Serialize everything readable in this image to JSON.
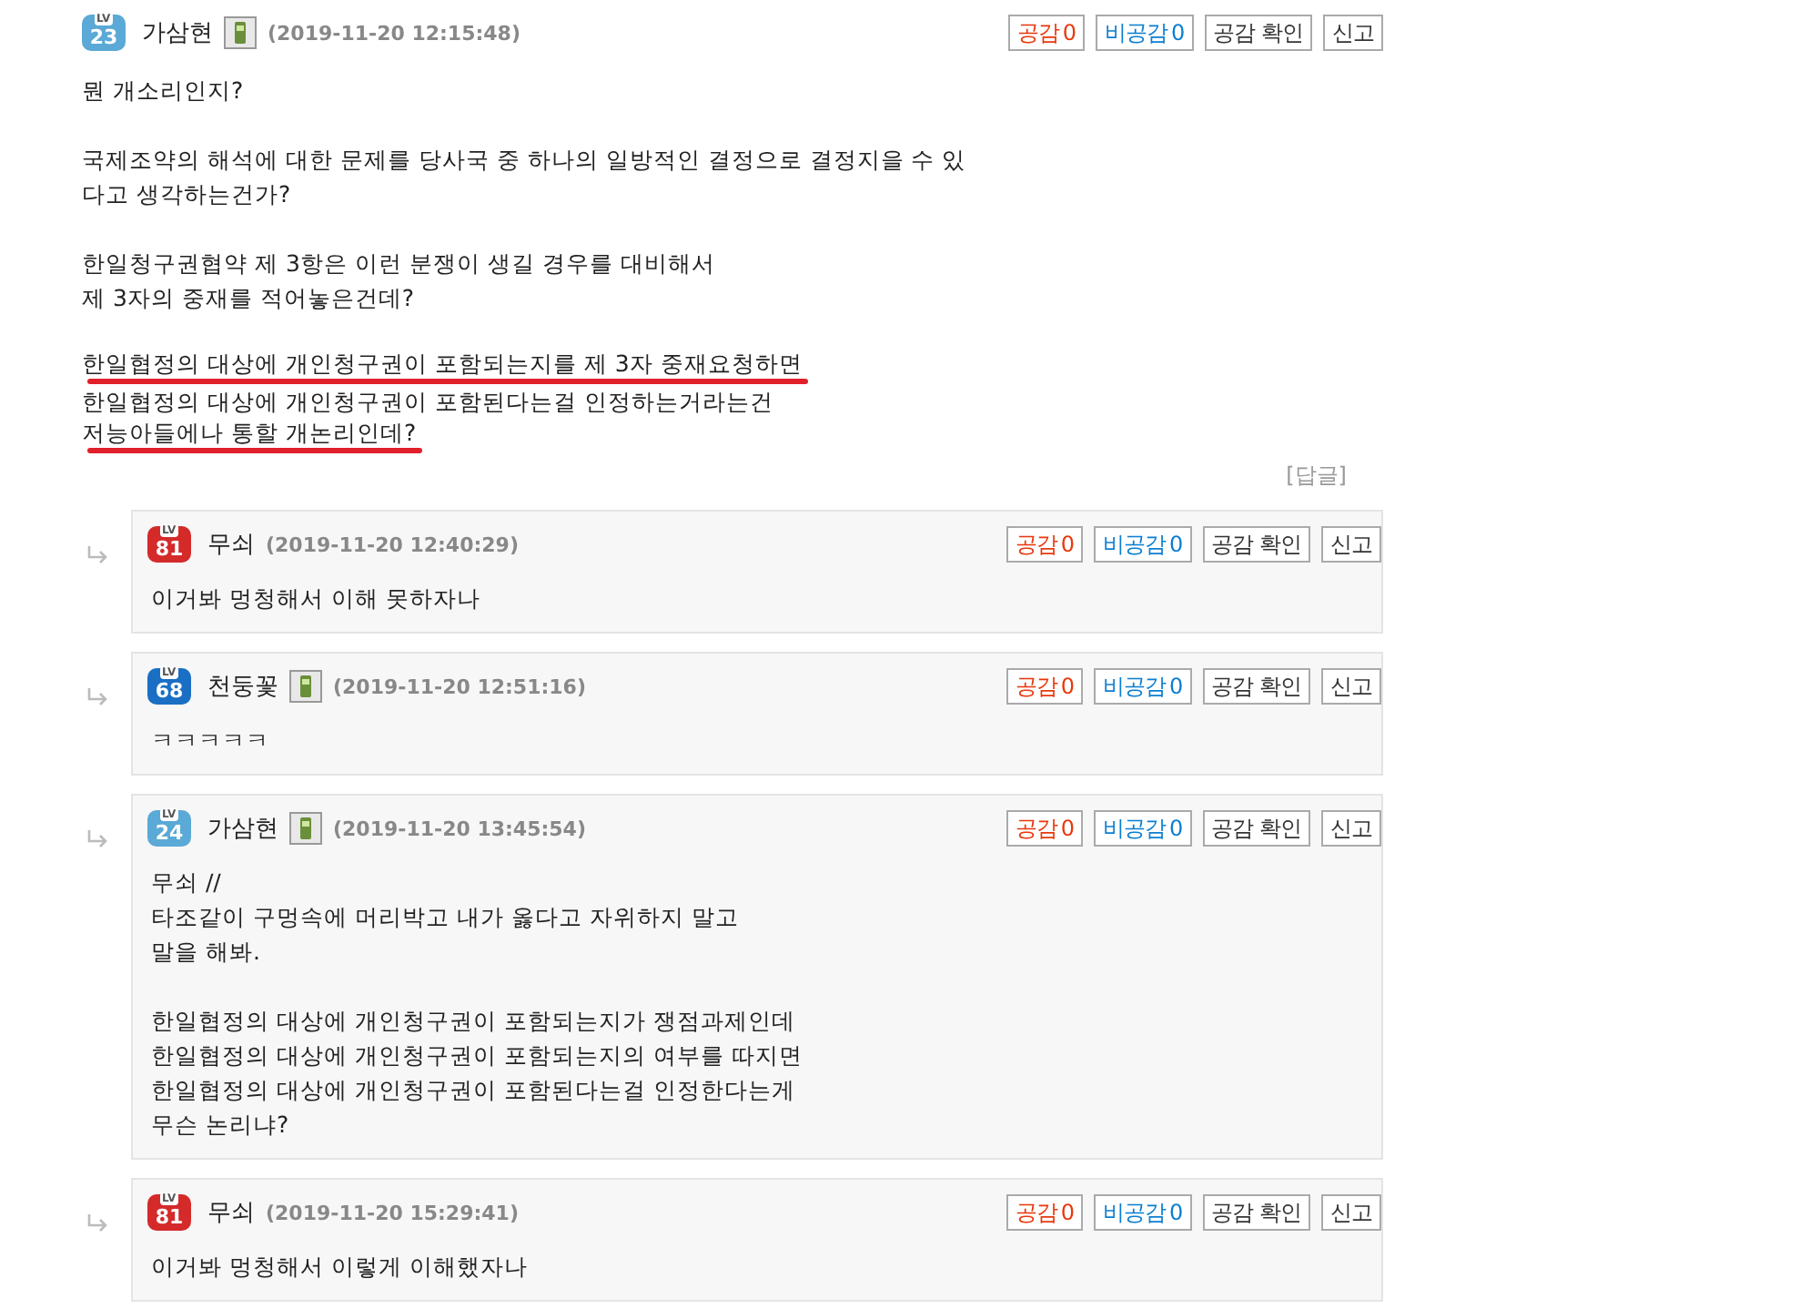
{
  "post": {
    "author": {
      "badge": {
        "label": "LV",
        "level": "23",
        "color": "#5aa9d6"
      },
      "name": "가삼현",
      "mobile": true,
      "date": "(2019-11-20 12:15:48)"
    },
    "actions": [
      {
        "kind": "like",
        "text": "공감",
        "count": "0"
      },
      {
        "kind": "dislike",
        "text": "비공감",
        "count": "0"
      },
      {
        "kind": "plain",
        "text": "공감 확인"
      },
      {
        "kind": "plain",
        "text": "신고"
      }
    ],
    "paragraphs": [
      [
        {
          "text": "뭔 개소리인지?",
          "marked": false
        }
      ],
      [
        {
          "text": "국제조약의 해석에 대한 문제를 당사국 중 하나의 일방적인 결정으로 결정지을 수 있",
          "marked": false
        },
        {
          "text": "다고 생각하는건가?",
          "marked": false
        }
      ],
      [
        {
          "text": "한일청구권협약 제 3항은 이런 분쟁이 생길 경우를 대비해서",
          "marked": false
        },
        {
          "text": "제 3자의 중재를 적어놓은건데?",
          "marked": false
        }
      ],
      [
        {
          "text": "한일협정의 대상에 개인청구권이 포함되는지를 제 3자 중재요청하면",
          "marked": true
        },
        {
          "text": "한일협정의 대상에 개인청구권이 포함된다는걸 인정하는거라는건",
          "marked": false
        },
        {
          "text": "저능아들에나 통할 개논리인데?",
          "marked": true
        }
      ]
    ],
    "reply_link": "[답글]"
  },
  "replies": [
    {
      "author": {
        "badge": {
          "label": "LV",
          "level": "81",
          "color": "#d42a2a"
        },
        "name": "무쇠",
        "mobile": false,
        "date": "(2019-11-20 12:40:29)"
      },
      "actions": [
        {
          "kind": "like",
          "text": "공감",
          "count": "0"
        },
        {
          "kind": "dislike",
          "text": "비공감",
          "count": "0"
        },
        {
          "kind": "plain",
          "text": "공감 확인"
        },
        {
          "kind": "plain",
          "text": "신고"
        }
      ],
      "paragraphs": [
        [
          {
            "text": "이거봐 멍청해서 이해 못하자나",
            "marked": false
          }
        ]
      ]
    },
    {
      "author": {
        "badge": {
          "label": "LV",
          "level": "68",
          "color": "#1a6fc4"
        },
        "name": "천둥꽃",
        "mobile": true,
        "date": "(2019-11-20 12:51:16)"
      },
      "actions": [
        {
          "kind": "like",
          "text": "공감",
          "count": "0"
        },
        {
          "kind": "dislike",
          "text": "비공감",
          "count": "0"
        },
        {
          "kind": "plain",
          "text": "공감 확인"
        },
        {
          "kind": "plain",
          "text": "신고"
        }
      ],
      "paragraphs": [
        [
          {
            "text": "ㅋㅋㅋㅋㅋ",
            "marked": false
          }
        ]
      ]
    },
    {
      "author": {
        "badge": {
          "label": "LV",
          "level": "24",
          "color": "#5aa9d6"
        },
        "name": "가삼현",
        "mobile": true,
        "date": "(2019-11-20 13:45:54)"
      },
      "actions": [
        {
          "kind": "like",
          "text": "공감",
          "count": "0"
        },
        {
          "kind": "dislike",
          "text": "비공감",
          "count": "0"
        },
        {
          "kind": "plain",
          "text": "공감 확인"
        },
        {
          "kind": "plain",
          "text": "신고"
        }
      ],
      "paragraphs": [
        [
          {
            "text": "무쇠 //",
            "marked": false
          },
          {
            "text": "타조같이 구멍속에 머리박고 내가 옳다고 자위하지 말고",
            "marked": false
          },
          {
            "text": "말을 해봐.",
            "marked": false
          }
        ],
        [
          {
            "text": "한일협정의 대상에 개인청구권이 포함되는지가 쟁점과제인데",
            "marked": false
          },
          {
            "text": "한일협정의 대상에 개인청구권이 포함되는지의 여부를 따지면",
            "marked": false
          },
          {
            "text": "한일협정의 대상에 개인청구권이 포함된다는걸 인정한다는게",
            "marked": false
          },
          {
            "text": "무슨 논리냐?",
            "marked": false
          }
        ]
      ]
    },
    {
      "author": {
        "badge": {
          "label": "LV",
          "level": "81",
          "color": "#d42a2a"
        },
        "name": "무쇠",
        "mobile": false,
        "date": "(2019-11-20 15:29:41)"
      },
      "actions": [
        {
          "kind": "like",
          "text": "공감",
          "count": "0"
        },
        {
          "kind": "dislike",
          "text": "비공감",
          "count": "0"
        },
        {
          "kind": "plain",
          "text": "공감 확인"
        },
        {
          "kind": "plain",
          "text": "신고"
        }
      ],
      "paragraphs": [
        [
          {
            "text": "이거봐 멍청해서 이렇게 이해했자나",
            "marked": false
          }
        ]
      ]
    }
  ]
}
